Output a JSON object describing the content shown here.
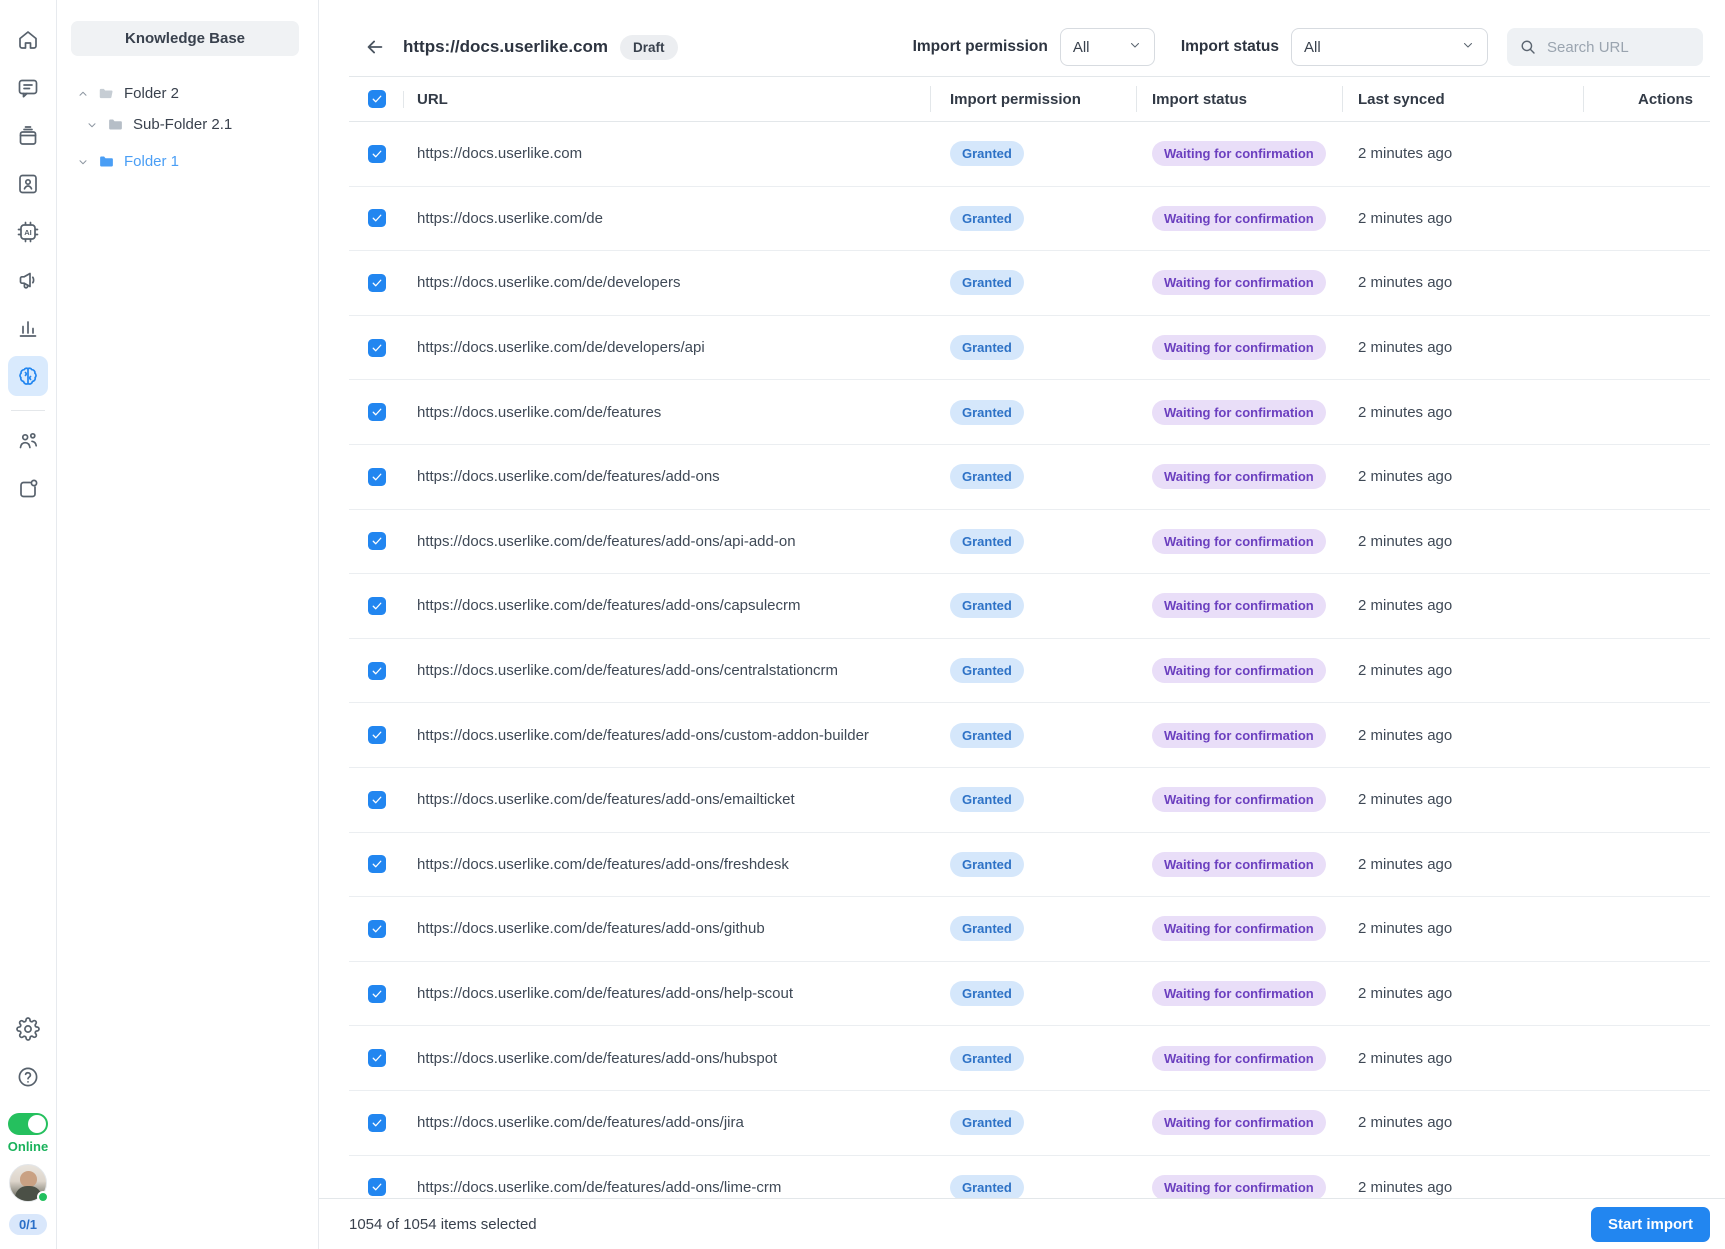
{
  "colors": {
    "accent_blue": "#2286f0",
    "light_blue": "#4a9ef5",
    "granted_bg": "#d5e7fb",
    "granted_text": "#2e72c6",
    "waiting_bg": "#e9def8",
    "waiting_text": "#6b3fbf",
    "online_green": "#25c05e"
  },
  "rail": {
    "icons": [
      "home",
      "messages",
      "inbox",
      "contacts",
      "ai-automation",
      "announcements",
      "analytics",
      "knowledge-base",
      "team",
      "integrations",
      "settings",
      "help"
    ],
    "active_icon": "knowledge-base",
    "online_label": "Online",
    "capacity_badge": "0/1"
  },
  "kb_panel": {
    "title": "Knowledge Base",
    "tree": [
      {
        "label": "Folder 2",
        "level": 0,
        "expanded": true,
        "selected": false
      },
      {
        "label": "Sub-Folder 2.1",
        "level": 1,
        "expanded": false,
        "selected": false
      },
      {
        "label": "Folder 1",
        "level": 0,
        "expanded": false,
        "selected": true
      }
    ]
  },
  "header": {
    "title": "https://docs.userlike.com",
    "badge": "Draft",
    "permission_filter_label": "Import permission",
    "permission_filter_value": "All",
    "status_filter_label": "Import status",
    "status_filter_value": "All",
    "search_placeholder": "Search URL"
  },
  "table": {
    "columns": [
      "URL",
      "Import permission",
      "Import status",
      "Last synced",
      "Actions"
    ],
    "rows": [
      {
        "url": "https://docs.userlike.com",
        "permission": "Granted",
        "status": "Waiting for confirmation",
        "last_synced": "2 minutes ago",
        "checked": true
      },
      {
        "url": "https://docs.userlike.com/de",
        "permission": "Granted",
        "status": "Waiting for confirmation",
        "last_synced": "2 minutes ago",
        "checked": true
      },
      {
        "url": "https://docs.userlike.com/de/developers",
        "permission": "Granted",
        "status": "Waiting for confirmation",
        "last_synced": "2 minutes ago",
        "checked": true
      },
      {
        "url": "https://docs.userlike.com/de/developers/api",
        "permission": "Granted",
        "status": "Waiting for confirmation",
        "last_synced": "2 minutes ago",
        "checked": true
      },
      {
        "url": "https://docs.userlike.com/de/features",
        "permission": "Granted",
        "status": "Waiting for confirmation",
        "last_synced": "2 minutes ago",
        "checked": true
      },
      {
        "url": "https://docs.userlike.com/de/features/add-ons",
        "permission": "Granted",
        "status": "Waiting for confirmation",
        "last_synced": "2 minutes ago",
        "checked": true
      },
      {
        "url": "https://docs.userlike.com/de/features/add-ons/api-add-on",
        "permission": "Granted",
        "status": "Waiting for confirmation",
        "last_synced": "2 minutes ago",
        "checked": true
      },
      {
        "url": "https://docs.userlike.com/de/features/add-ons/capsulecrm",
        "permission": "Granted",
        "status": "Waiting for confirmation",
        "last_synced": "2 minutes ago",
        "checked": true
      },
      {
        "url": "https://docs.userlike.com/de/features/add-ons/centralstationcrm",
        "permission": "Granted",
        "status": "Waiting for confirmation",
        "last_synced": "2 minutes ago",
        "checked": true
      },
      {
        "url": "https://docs.userlike.com/de/features/add-ons/custom-addon-builder",
        "permission": "Granted",
        "status": "Waiting for confirmation",
        "last_synced": "2 minutes ago",
        "checked": true
      },
      {
        "url": "https://docs.userlike.com/de/features/add-ons/emailticket",
        "permission": "Granted",
        "status": "Waiting for confirmation",
        "last_synced": "2 minutes ago",
        "checked": true
      },
      {
        "url": "https://docs.userlike.com/de/features/add-ons/freshdesk",
        "permission": "Granted",
        "status": "Waiting for confirmation",
        "last_synced": "2 minutes ago",
        "checked": true
      },
      {
        "url": "https://docs.userlike.com/de/features/add-ons/github",
        "permission": "Granted",
        "status": "Waiting for confirmation",
        "last_synced": "2 minutes ago",
        "checked": true
      },
      {
        "url": "https://docs.userlike.com/de/features/add-ons/help-scout",
        "permission": "Granted",
        "status": "Waiting for confirmation",
        "last_synced": "2 minutes ago",
        "checked": true
      },
      {
        "url": "https://docs.userlike.com/de/features/add-ons/hubspot",
        "permission": "Granted",
        "status": "Waiting for confirmation",
        "last_synced": "2 minutes ago",
        "checked": true
      },
      {
        "url": "https://docs.userlike.com/de/features/add-ons/jira",
        "permission": "Granted",
        "status": "Waiting for confirmation",
        "last_synced": "2 minutes ago",
        "checked": true
      },
      {
        "url": "https://docs.userlike.com/de/features/add-ons/lime-crm",
        "permission": "Granted",
        "status": "Waiting for confirmation",
        "last_synced": "2 minutes ago",
        "checked": true
      }
    ]
  },
  "footer": {
    "selection_text": "1054 of 1054 items selected",
    "start_button": "Start import"
  }
}
